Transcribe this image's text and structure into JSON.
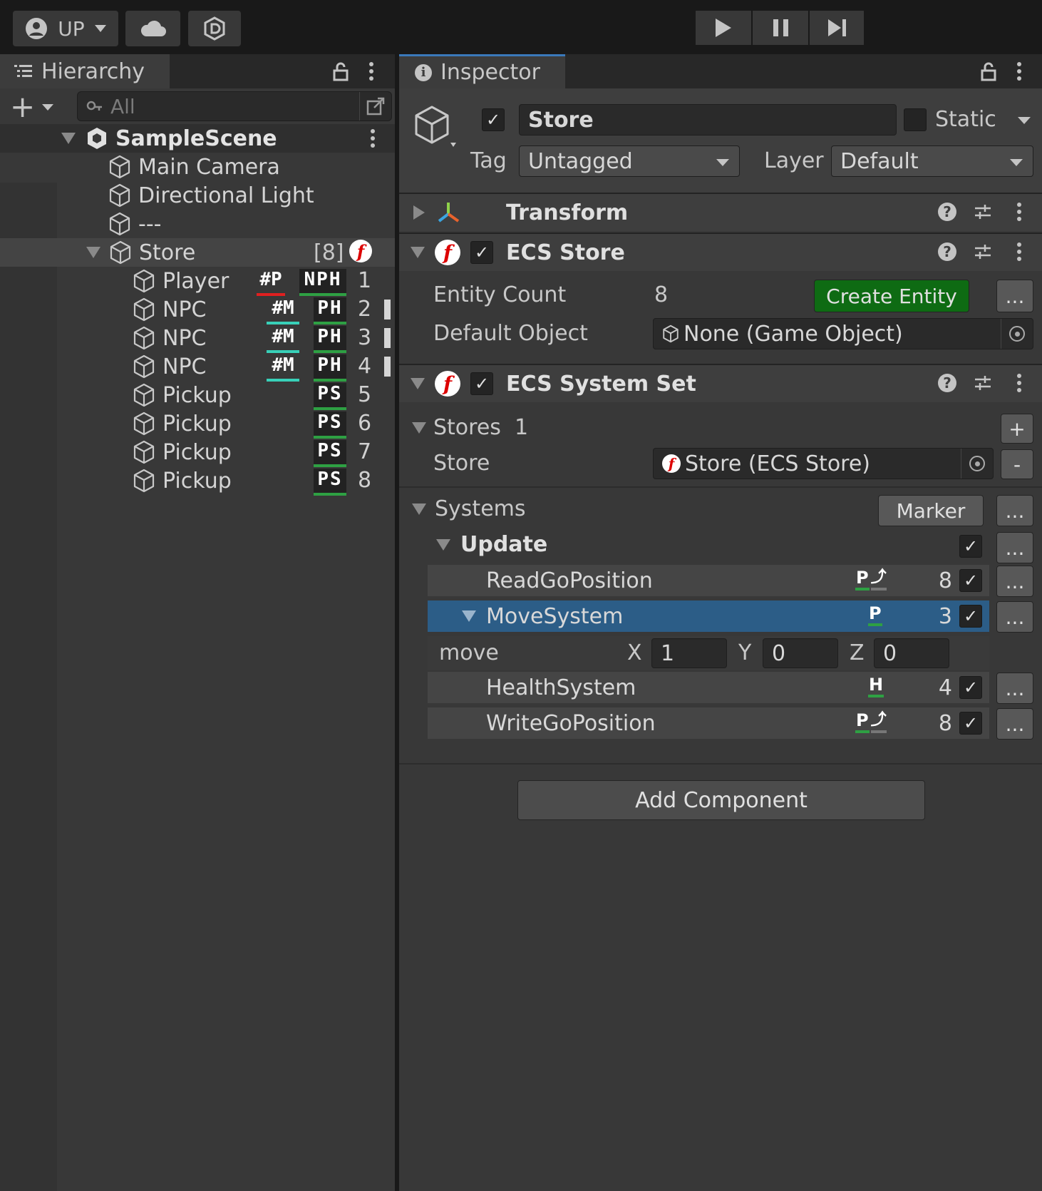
{
  "toolbar": {
    "account_label": "UP"
  },
  "hierarchy": {
    "tab_title": "Hierarchy",
    "search_placeholder": "All",
    "scene_name": "SampleScene",
    "items": [
      {
        "name": "Main Camera"
      },
      {
        "name": "Directional Light"
      },
      {
        "name": "---"
      }
    ],
    "store": {
      "name": "Store",
      "count": "[8]"
    },
    "entities": [
      {
        "name": "Player",
        "tag": "#P",
        "components": "NPH",
        "id": "1"
      },
      {
        "name": "NPC",
        "tag": "#M",
        "components": "PH",
        "id": "2"
      },
      {
        "name": "NPC",
        "tag": "#M",
        "components": "PH",
        "id": "3"
      },
      {
        "name": "NPC",
        "tag": "#M",
        "components": "PH",
        "id": "4"
      },
      {
        "name": "Pickup",
        "tag": "",
        "components": "PS",
        "id": "5"
      },
      {
        "name": "Pickup",
        "tag": "",
        "components": "PS",
        "id": "6"
      },
      {
        "name": "Pickup",
        "tag": "",
        "components": "PS",
        "id": "7"
      },
      {
        "name": "Pickup",
        "tag": "",
        "components": "PS",
        "id": "8"
      }
    ]
  },
  "inspector": {
    "tab_title": "Inspector",
    "object_name": "Store",
    "static_label": "Static",
    "tag_label": "Tag",
    "tag_value": "Untagged",
    "layer_label": "Layer",
    "layer_value": "Default",
    "transform_title": "Transform",
    "ecs_store": {
      "title": "ECS Store",
      "entity_count_label": "Entity Count",
      "entity_count_value": "8",
      "create_entity_label": "Create Entity",
      "more_label": "...",
      "default_object_label": "Default Object",
      "default_object_value": "None (Game Object)"
    },
    "system_set": {
      "title": "ECS System Set",
      "stores_label": "Stores",
      "stores_count": "1",
      "add_label": "+",
      "remove_label": "-",
      "store_label": "Store",
      "store_value": "Store (ECS Store)",
      "systems_label": "Systems",
      "marker_label": "Marker",
      "update_label": "Update",
      "systems": [
        {
          "name": "ReadGoPosition",
          "badge": "P",
          "count": "8"
        },
        {
          "name": "MoveSystem",
          "badge": "P",
          "count": "3"
        },
        {
          "name": "HealthSystem",
          "badge": "H",
          "count": "4"
        },
        {
          "name": "WriteGoPosition",
          "badge": "P",
          "count": "8"
        }
      ],
      "move_label": "move",
      "x_label": "X",
      "x_value": "1",
      "y_label": "Y",
      "y_value": "0",
      "z_label": "Z",
      "z_value": "0"
    },
    "add_component_label": "Add Component"
  },
  "colors": {
    "accent_blue": "#2c5d87",
    "green_button": "#0c6e14",
    "badge_green": "#2ea043",
    "badge_teal": "#38d0b8",
    "badge_red": "#e02020"
  }
}
